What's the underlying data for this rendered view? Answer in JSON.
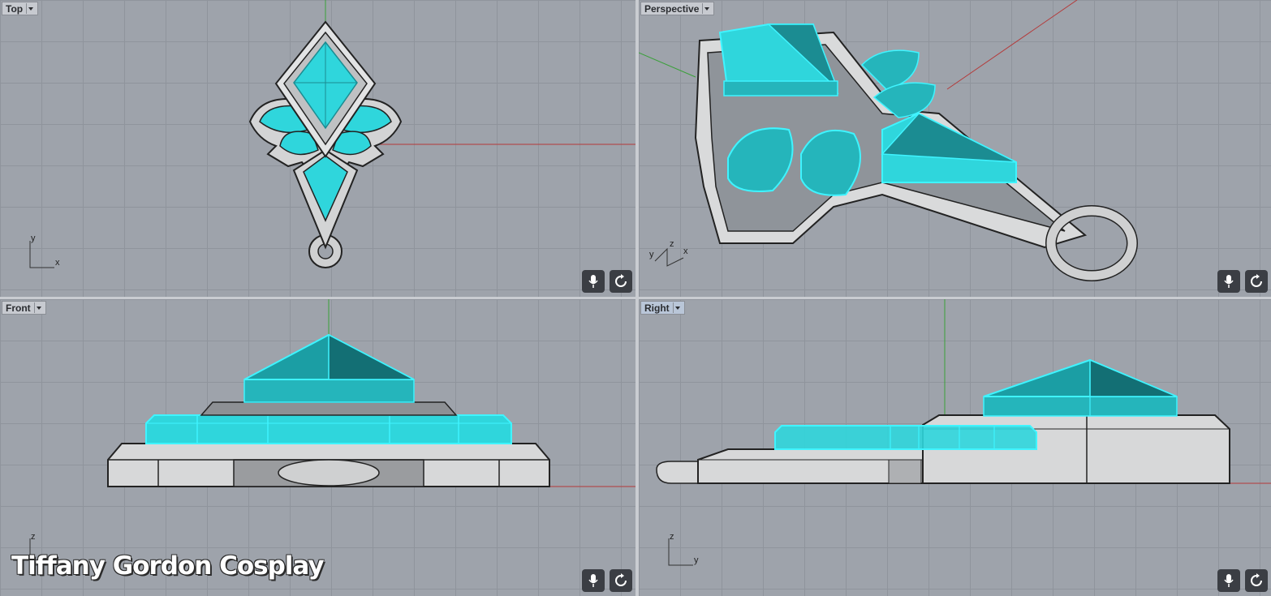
{
  "viewports": {
    "top": {
      "label": "Top",
      "axis_x": "x",
      "axis_y": "y"
    },
    "perspective": {
      "label": "Perspective",
      "axis_x": "x",
      "axis_y": "y",
      "axis_z": "z"
    },
    "front": {
      "label": "Front",
      "axis_x": "x",
      "axis_z": "z"
    },
    "right": {
      "label": "Right",
      "axis_y": "y",
      "axis_z": "z"
    }
  },
  "buttons": {
    "mic_icon": "microphone-icon",
    "rotate_icon": "rotate-icon"
  },
  "watermark": "Tiffany Gordon Cosplay",
  "colors": {
    "viewport_bg": "#9ea3ab",
    "grid": "#8f949c",
    "gem": "#2fd6dc",
    "gem_edge": "#3ff4ff",
    "metal": "#d6d7d8",
    "x_axis": "#b43a3a",
    "y_axis": "#3aa03a"
  }
}
